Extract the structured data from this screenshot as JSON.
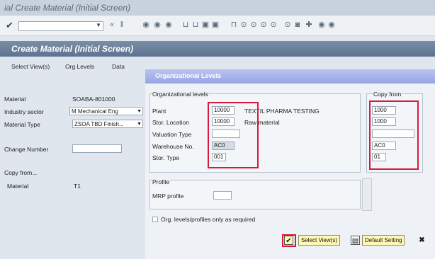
{
  "window": {
    "title": "ial Create Material (Initial Screen)"
  },
  "toolbar": {
    "check_icon": "✔",
    "command_field": "",
    "icons": [
      "«",
      "ǁ",
      "◉",
      "◉",
      "◉",
      "⊔",
      "⊔",
      "▣",
      "▣",
      "⊓",
      "⊙",
      "⊙",
      "⊙",
      "⊙",
      "⊙",
      "◙",
      "✚",
      "◉",
      "◉"
    ]
  },
  "header": {
    "title": "Create Material (Initial Screen)"
  },
  "subtabs": [
    "Select View(s)",
    "Org Levels",
    "Data"
  ],
  "left": {
    "material_label": "Material",
    "material_value": "SOABA-801000",
    "industry_label": "Industry sector",
    "industry_value": "M Mechanical Eng",
    "type_label": "Material Type",
    "type_value": "ZSOA TBD Finish...",
    "change_label": "Change Number",
    "copy_label": "Copy from...",
    "copy_material_label": "Material",
    "copy_material_value": "T1"
  },
  "dialog": {
    "title": "Organizational Levels",
    "org_group_label": "Organizational levels",
    "copy_group_label": "Copy from",
    "plant_label": "Plant",
    "plant_value": "10000",
    "plant_desc": "TEXTIL PHARMA TESTING",
    "sloc_label": "Stor. Location",
    "sloc_value": "10000",
    "sloc_desc": "Raw material",
    "valtype_label": "Valuation Type",
    "warehouse_label": "Warehouse No.",
    "warehouse_value": "AC0",
    "storage_type_label": "Stor. Type",
    "storage_type_value": "001",
    "copy_plant": "1000",
    "copy_sloc": "1000",
    "copy_wh": "AC0",
    "copy_st": "01",
    "profile_group_label": "Profile",
    "mrp_label": "MRP profile",
    "checkbox_label": "Org. levels/profiles only as required",
    "select_views_button": "Select View(s)",
    "default_setting_button": "Default Setting"
  },
  "colors": {
    "highlight": "#d7193f",
    "button_bg": "#fff8b4",
    "header_band": "#5d7390",
    "dialog_head": "#98a5e4"
  }
}
